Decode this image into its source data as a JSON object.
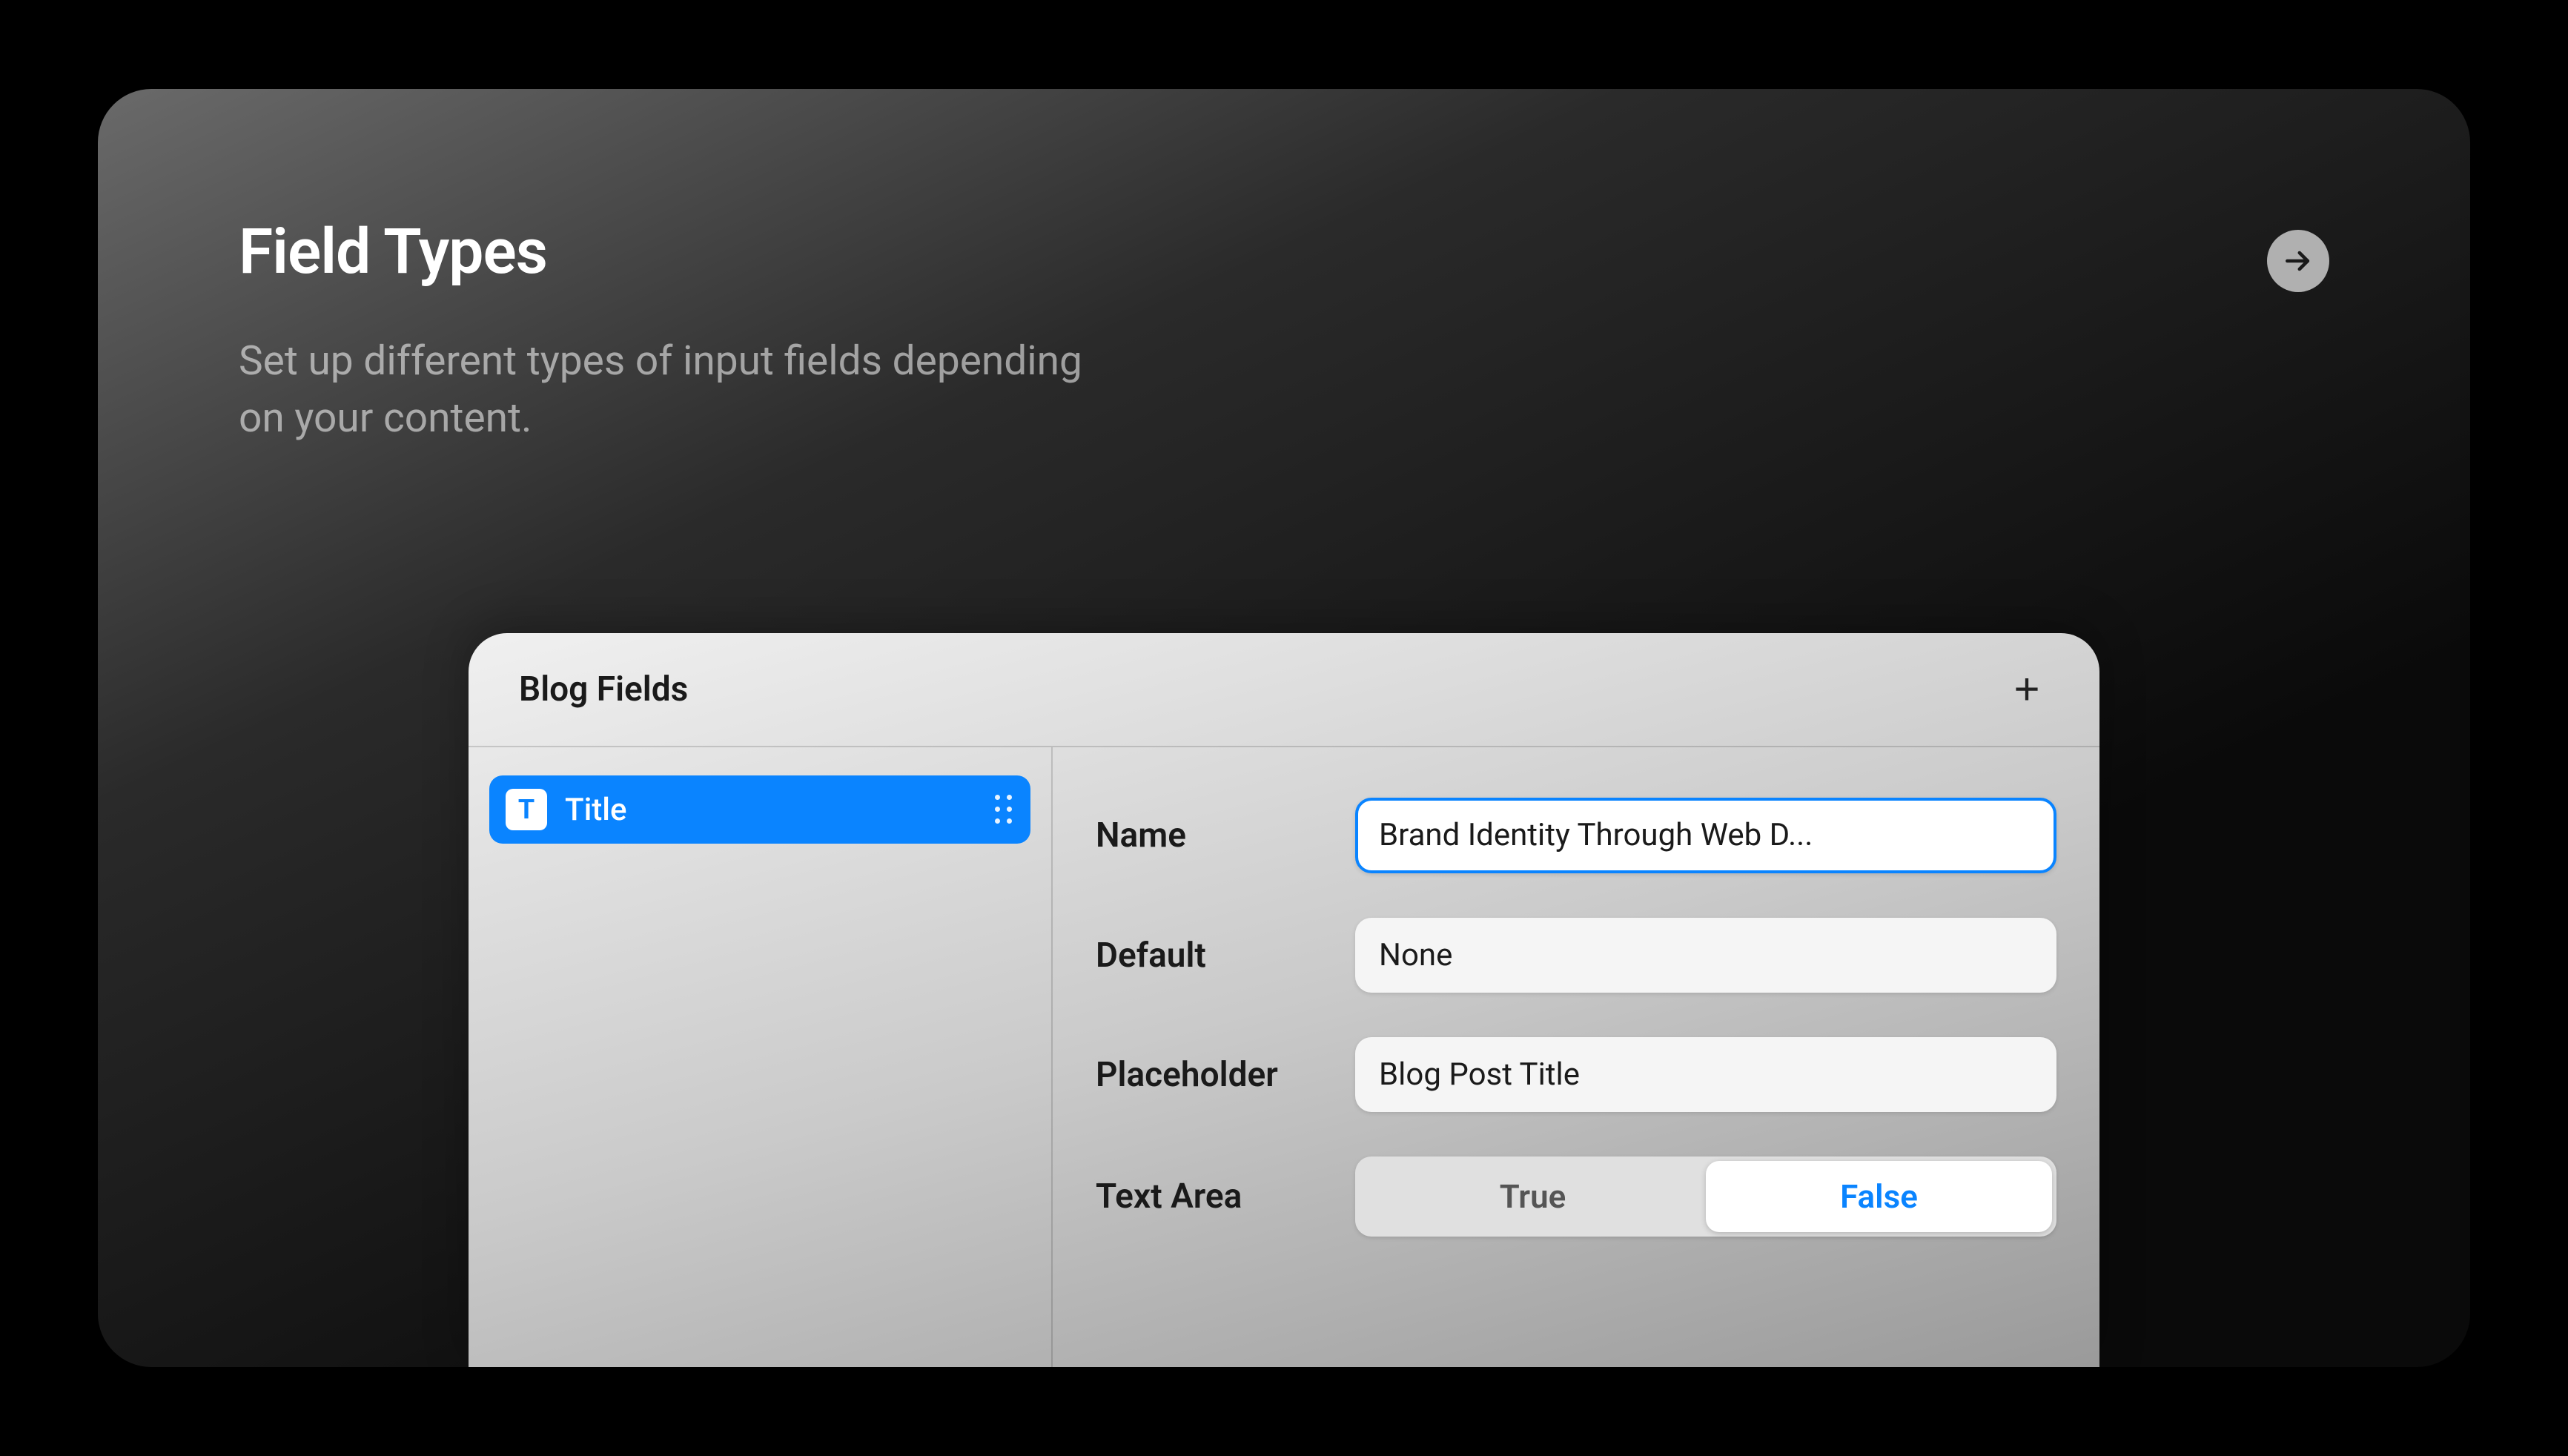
{
  "card": {
    "title": "Field Types",
    "subtitle": "Set up different types of input fields depending on your content."
  },
  "panel": {
    "title": "Blog Fields",
    "sidebar": {
      "items": [
        {
          "icon_letter": "T",
          "label": "Title"
        }
      ]
    },
    "form": {
      "name": {
        "label": "Name",
        "value": "Brand Identity Through Web D..."
      },
      "default": {
        "label": "Default",
        "value": "None"
      },
      "placeholder": {
        "label": "Placeholder",
        "value": "Blog Post Title"
      },
      "textarea": {
        "label": "Text Area",
        "options": {
          "true": "True",
          "false": "False"
        },
        "selected": "false"
      }
    }
  }
}
